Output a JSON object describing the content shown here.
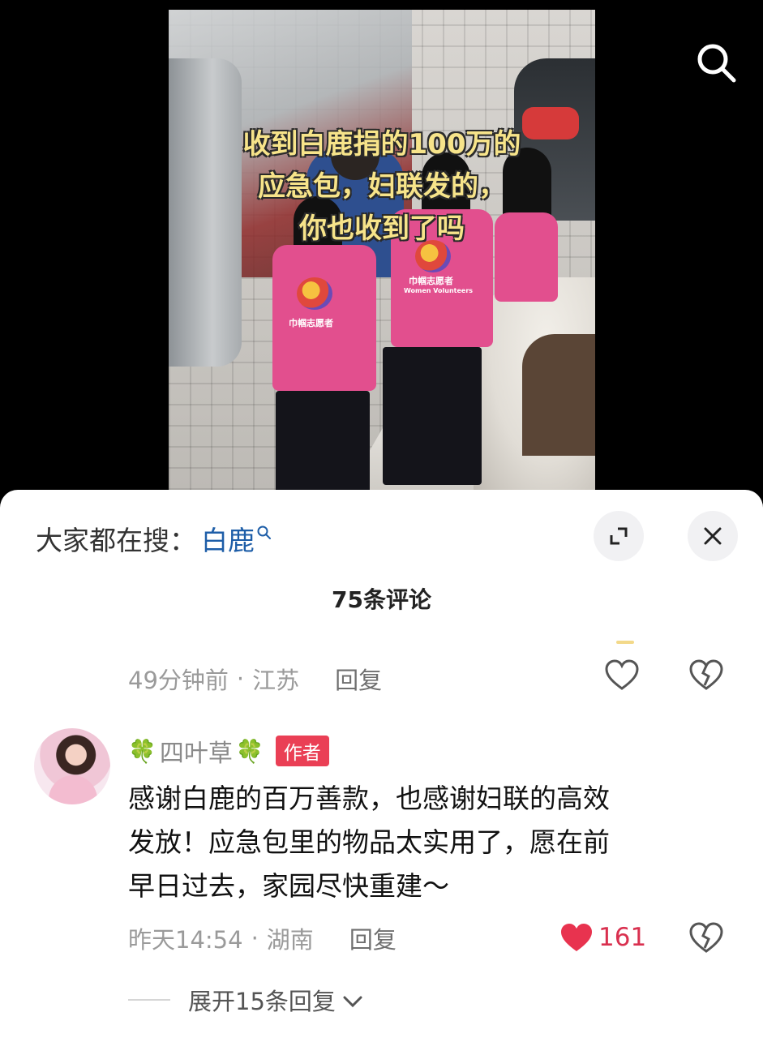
{
  "video": {
    "caption_lines": [
      "收到白鹿捐的100万的",
      "应急包，妇联发的，",
      "你也收到了吗"
    ],
    "vest_text_cn": "巾帼志愿者",
    "vest_text_en": "Women Volunteers",
    "search_icon": "search-icon"
  },
  "comment_sheet": {
    "trending_label": "大家都在搜：",
    "trending_keyword": "白鹿",
    "trending_icon": "search-icon",
    "expand_icon": "expand-icon",
    "close_icon": "close-icon",
    "comment_count": "75条评论",
    "comments": [
      {
        "time": "49分钟前",
        "location": "江苏",
        "reply_label": "回复",
        "liked": false
      },
      {
        "username": "四叶草",
        "clover": "🍀",
        "author_badge": "作者",
        "text_lines": [
          "感谢白鹿的百万善款，也感谢妇联的高效",
          "发放！应急包里的物品太实用了，愿在前",
          "早日过去，家园尽快重建～"
        ],
        "time": "昨天14:54",
        "location": "湖南",
        "reply_label": "回复",
        "like_count": "161",
        "liked": true,
        "expand_replies": "展开15条回复"
      }
    ],
    "colors": {
      "keyword": "#1e5ea8",
      "author_badge": "#ea3f55",
      "like_active": "#d9304f"
    }
  }
}
